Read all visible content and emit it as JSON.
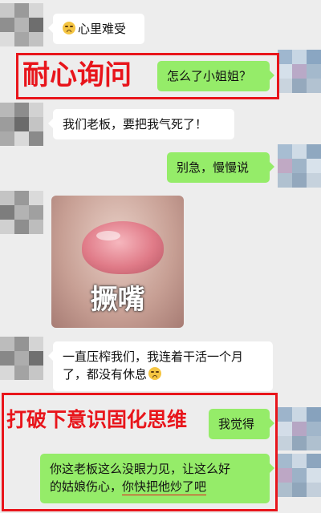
{
  "messages": [
    {
      "side": "in",
      "text": "心里难受",
      "emoji": "crying-face-icon"
    },
    {
      "side": "out",
      "text": "怎么了小姐姐？"
    },
    {
      "side": "in",
      "text": "我们老板，要把我气死了！"
    },
    {
      "side": "out",
      "text": "别急，慢慢说"
    },
    {
      "side": "in",
      "sticker_caption": "撅嘴"
    },
    {
      "side": "in",
      "line1": "一直压榨我们，我连着干活一个月",
      "line2": "了，都没有休息",
      "emoji": "crying-face-icon"
    },
    {
      "side": "out",
      "text": "我觉得"
    },
    {
      "side": "out",
      "line1": "你这老板这么没眼力见，让这么好",
      "line2_plain": "的姑娘伤心，",
      "line2_underlined": "你快把他炒了吧"
    }
  ],
  "annotations": {
    "patient_ask": "耐心询问",
    "break_thinking": "打破下意识固化思维"
  },
  "colors": {
    "chat_background": "#ededed",
    "incoming_bubble": "#ffffff",
    "outgoing_bubble": "#95ec69",
    "annotation_red": "#e8151b"
  }
}
